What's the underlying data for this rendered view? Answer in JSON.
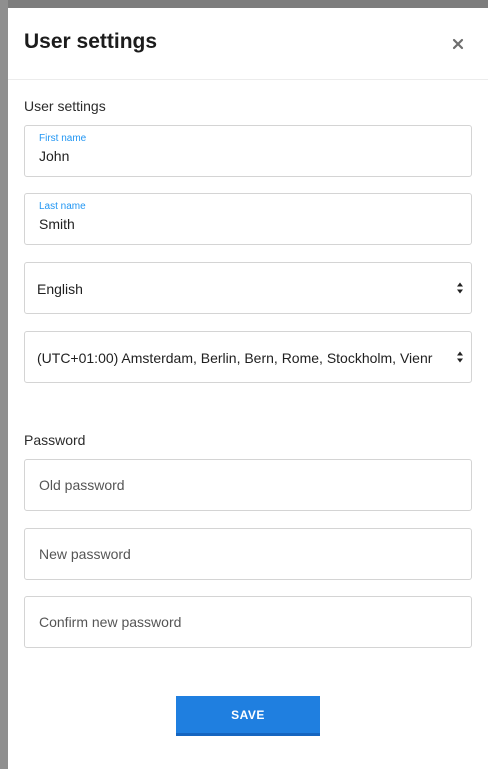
{
  "modal": {
    "title": "User settings",
    "close_icon": "close-icon"
  },
  "user_section": {
    "label": "User settings",
    "first_name": {
      "label": "First name",
      "value": "John"
    },
    "last_name": {
      "label": "Last name",
      "value": "Smith"
    },
    "language": {
      "value": "English"
    },
    "timezone": {
      "value": "(UTC+01:00) Amsterdam, Berlin, Bern, Rome, Stockholm, Vienr"
    }
  },
  "password_section": {
    "label": "Password",
    "old_password": {
      "placeholder": "Old password"
    },
    "new_password": {
      "placeholder": "New password"
    },
    "confirm_password": {
      "placeholder": "Confirm new password"
    }
  },
  "actions": {
    "save_label": "SAVE"
  },
  "colors": {
    "accent": "#2196f3",
    "button": "#1f7fe0",
    "backdrop": "#7d7d7d"
  }
}
